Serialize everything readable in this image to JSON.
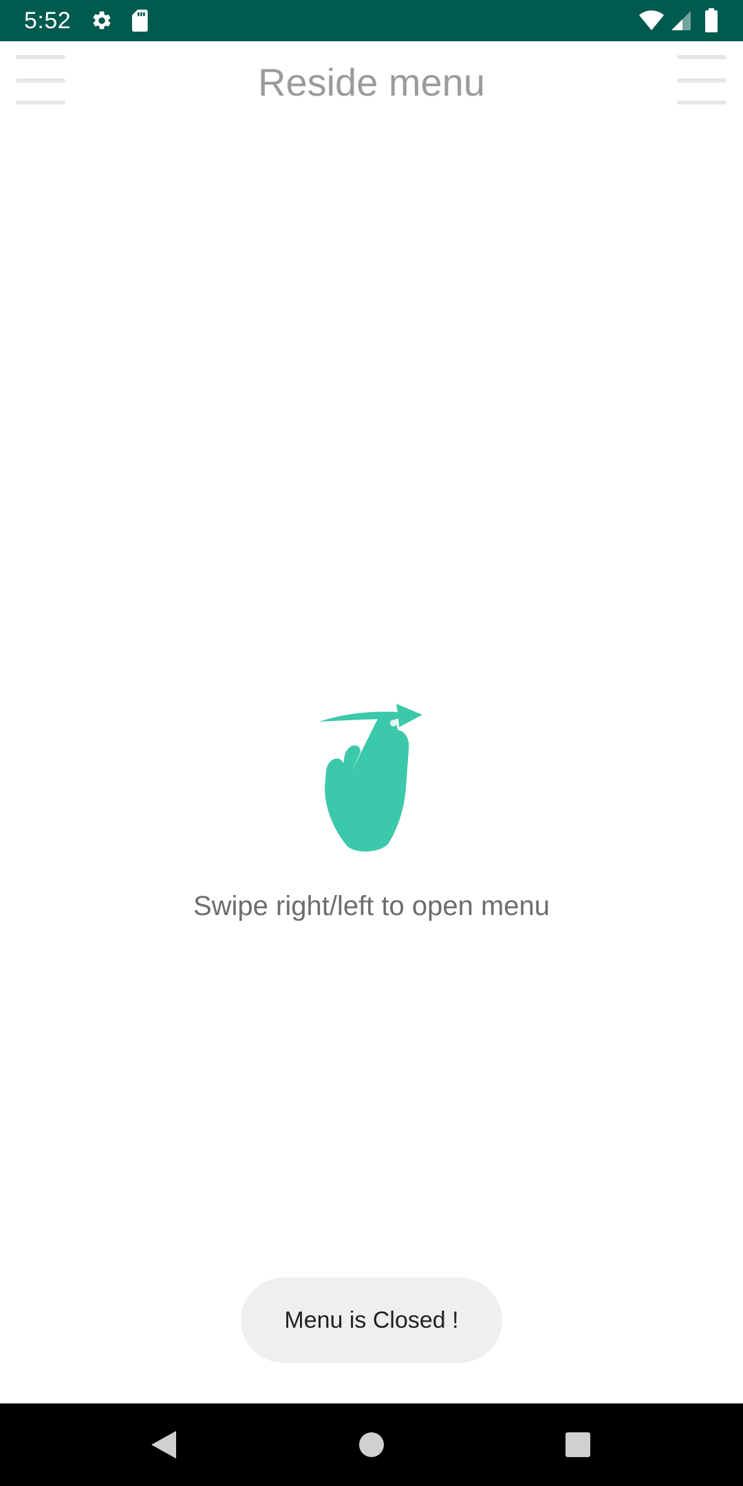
{
  "status_bar": {
    "time": "5:52",
    "background_color": "#005a4e",
    "icons": [
      "settings-gear-icon",
      "sd-card-icon",
      "wifi-icon",
      "cellular-signal-icon",
      "battery-icon"
    ]
  },
  "app_bar": {
    "title": "Reside menu",
    "left_menu_icon": "hamburger-menu-icon",
    "right_menu_icon": "hamburger-menu-icon"
  },
  "content": {
    "gesture_icon": "swipe-gesture-icon",
    "accent_color": "#3cc8ab",
    "hint": "Swipe right/left to open menu"
  },
  "toast": {
    "message": "Menu is Closed !"
  },
  "nav_bar": {
    "buttons": [
      "back-icon",
      "home-icon",
      "recents-icon"
    ]
  }
}
